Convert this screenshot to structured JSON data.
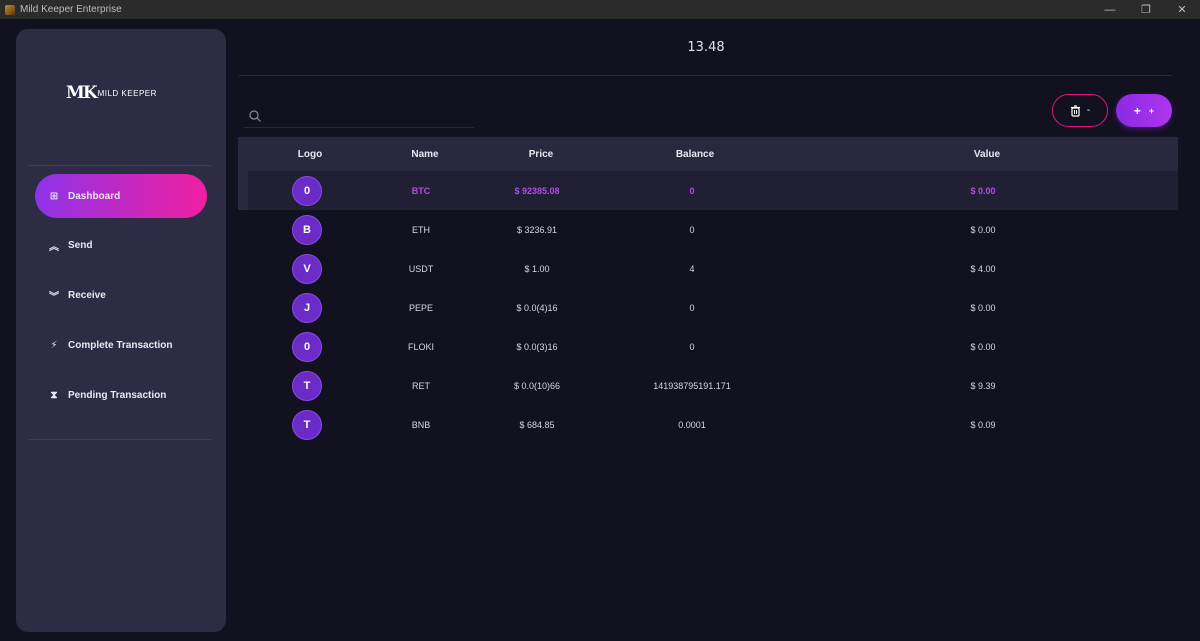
{
  "window": {
    "title": "Mild Keeper Enterprise",
    "controls": [
      "—",
      "❐",
      "✕"
    ]
  },
  "sidebar": {
    "logo_mark": "MK",
    "logo_text": "MILD KEEPER",
    "items": [
      {
        "label": "Dashboard",
        "icon": "dashboard-grid-icon",
        "glyph": "⊞",
        "active": true
      },
      {
        "label": "Send",
        "icon": "double-chevron-up-icon",
        "glyph": "︽",
        "active": false
      },
      {
        "label": "Receive",
        "icon": "double-chevron-down-icon",
        "glyph": "︾",
        "active": false
      },
      {
        "label": "Complete Transaction",
        "icon": "lightning-icon",
        "glyph": "⚡",
        "active": false
      },
      {
        "label": "Pending Transaction",
        "icon": "hourglass-icon",
        "glyph": "⧗",
        "active": false
      }
    ]
  },
  "header": {
    "total": "13.48"
  },
  "search": {
    "placeholder": "",
    "value": ""
  },
  "actions": {
    "delete_label": "-",
    "add_label": "+"
  },
  "table": {
    "columns": [
      "Logo",
      "Name",
      "Price",
      "Balance",
      "Value"
    ],
    "rows": [
      {
        "logo": "0",
        "name": "BTC",
        "price": "$ 92385.08",
        "balance": "0",
        "value": "$ 0.00",
        "selected": true
      },
      {
        "logo": "B",
        "name": "ETH",
        "price": "$ 3236.91",
        "balance": "0",
        "value": "$ 0.00"
      },
      {
        "logo": "V",
        "name": "USDT",
        "price": "$ 1.00",
        "balance": "4",
        "value": "$ 4.00"
      },
      {
        "logo": "J",
        "name": "PEPE",
        "price": "$ 0.0(4)16",
        "balance": "0",
        "value": "$ 0.00"
      },
      {
        "logo": "0",
        "name": "FLOKI",
        "price": "$ 0.0(3)16",
        "balance": "0",
        "value": "$ 0.00"
      },
      {
        "logo": "T",
        "name": "RET",
        "price": "$ 0.0(10)66",
        "balance": "141938795191.171",
        "value": "$ 9.39"
      },
      {
        "logo": "T",
        "name": "BNB",
        "price": "$ 684.85",
        "balance": "0.0001",
        "value": "$ 0.09"
      }
    ]
  },
  "colors": {
    "background": "#12111f",
    "sidebar": "#2c2c44",
    "accent_purple": "#8f33e8",
    "accent_pink": "#f01fa0",
    "selected_text": "#b44ce8"
  }
}
